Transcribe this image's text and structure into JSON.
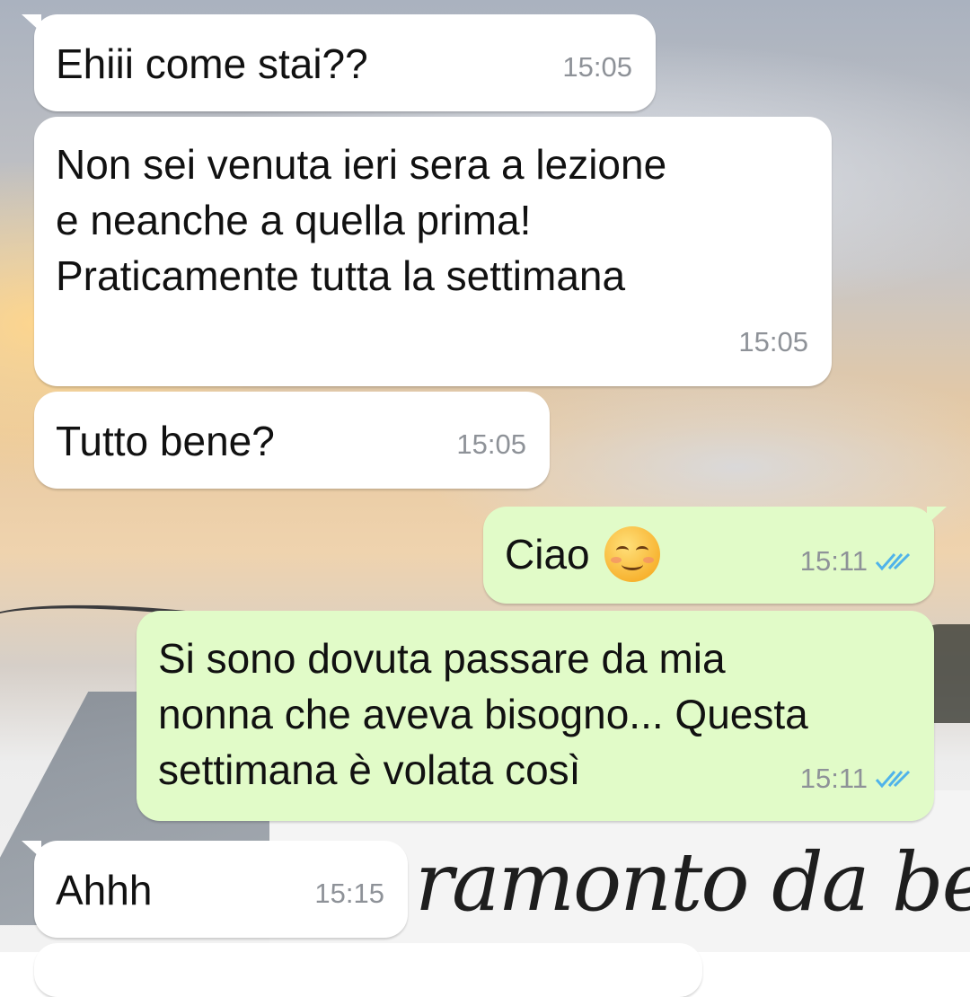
{
  "wallpaper": {
    "caption": "ramonto da be"
  },
  "colors": {
    "incoming_bubble": "#ffffff",
    "outgoing_bubble": "#e1fbc8",
    "read_ticks": "#4fb3ea",
    "timestamp": "#8e9298"
  },
  "messages": [
    {
      "direction": "incoming",
      "text": "Ehiii come stai??",
      "time": "15:05"
    },
    {
      "direction": "incoming",
      "text": "Non sei venuta ieri sera a lezione\ne neanche a quella prima!\nPraticamente tutta la settimana",
      "time": "15:05"
    },
    {
      "direction": "incoming",
      "text": "Tutto bene?",
      "time": "15:05"
    },
    {
      "direction": "outgoing",
      "text": "Ciao",
      "emoji": "smiling-face-with-blush-emoji",
      "time": "15:11",
      "status": "read"
    },
    {
      "direction": "outgoing",
      "text": "Si sono dovuta passare da mia\nnonna che aveva bisogno... Questa\nsettimana è volata così",
      "time": "15:11",
      "status": "read"
    },
    {
      "direction": "incoming",
      "text": "Ahhh",
      "time": "15:15"
    }
  ]
}
